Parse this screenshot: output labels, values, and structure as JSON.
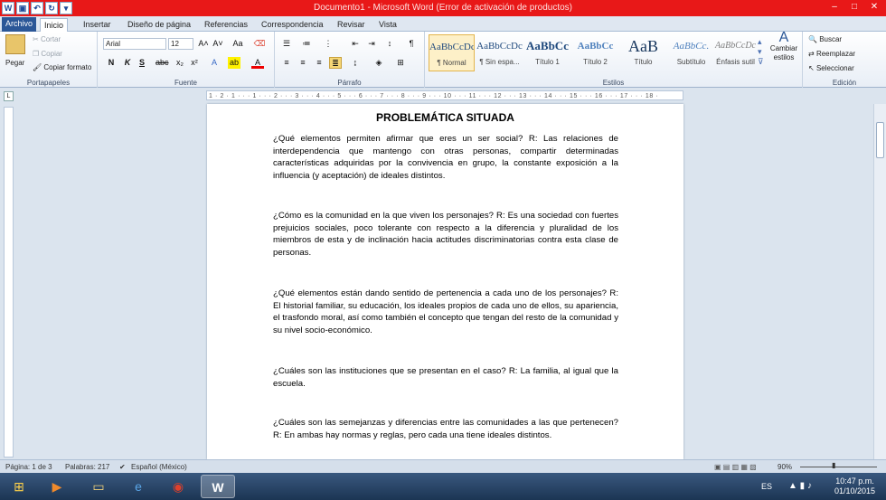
{
  "window": {
    "title": "Documento1 - Microsoft Word (Error de activación de productos)"
  },
  "tabs": [
    "Archivo",
    "Inicio",
    "Insertar",
    "Diseño de página",
    "Referencias",
    "Correspondencia",
    "Revisar",
    "Vista"
  ],
  "clipboard": {
    "paste": "Pegar",
    "cut": "Cortar",
    "copy": "Copiar",
    "format_painter": "Copiar formato",
    "label": "Portapapeles"
  },
  "font": {
    "name": "Arial",
    "size": "12",
    "label": "Fuente"
  },
  "paragraph": {
    "label": "Párrafo"
  },
  "styles": {
    "items": [
      {
        "preview": "AaBbCcDc",
        "name": "¶ Normal"
      },
      {
        "preview": "AaBbCcDc",
        "name": "¶ Sin espa..."
      },
      {
        "preview": "AaBbCc",
        "name": "Título 1"
      },
      {
        "preview": "AaBbCc",
        "name": "Título 2"
      },
      {
        "preview": "AaB",
        "name": "Título"
      },
      {
        "preview": "AaBbCc.",
        "name": "Subtítulo"
      },
      {
        "preview": "AaBbCcDc",
        "name": "Énfasis sutil"
      }
    ],
    "change": "Cambiar estilos",
    "label": "Estilos"
  },
  "editing": {
    "find": "Buscar",
    "replace": "Reemplazar",
    "select": "Seleccionar",
    "label": "Edición"
  },
  "ruler": {
    "marks": "1 · 2 · 1 · · · 1 · · · 2 · · · 3 · · · 4 · · · 5 · · · 6 · · · 7 · · · 8 · · · 9 · · · 10 · · · 11 · · · 12 · · · 13 · · · 14 · · · 15 · · · 16 · · · 17 · · · 18 ·"
  },
  "document": {
    "title": "PROBLEMÁTICA SITUADA",
    "paragraphs": [
      "¿Qué elementos permiten afirmar que eres un ser social? R: Las relaciones de interdependencia que mantengo con otras personas, compartir determinadas características adquiridas por la convivencia en grupo, la constante exposición a la influencia (y aceptación) de ideales distintos.",
      "¿Cómo es la comunidad en la que viven los personajes? R: Es una sociedad con fuertes prejuicios sociales, poco tolerante con respecto a la diferencia y pluralidad de los miembros de esta y de inclinación hacia actitudes discriminatorias contra esta clase de personas.",
      "¿Qué elementos están dando sentido de pertenencia a cada uno de los personajes? R: El historial familiar, su educación, los ideales propios de cada uno de ellos, su apariencia, el trasfondo moral, así como también el concepto que tengan del resto de la comunidad y su nivel socio-económico.",
      "¿Cuáles son las instituciones que se presentan en el caso? R: La familia, al igual que la escuela.",
      "¿Cuáles son las semejanzas y diferencias entre las comunidades a las que pertenecen? R: En ambas hay normas y reglas, pero cada una tiene ideales distintos."
    ]
  },
  "status": {
    "page": "Página: 1 de 3",
    "words": "Palabras: 217",
    "language": "Español (México)",
    "zoom": "90%"
  },
  "taskbar": {
    "lang": "ES",
    "time": "10:47 p.m.",
    "date": "01/10/2015"
  }
}
